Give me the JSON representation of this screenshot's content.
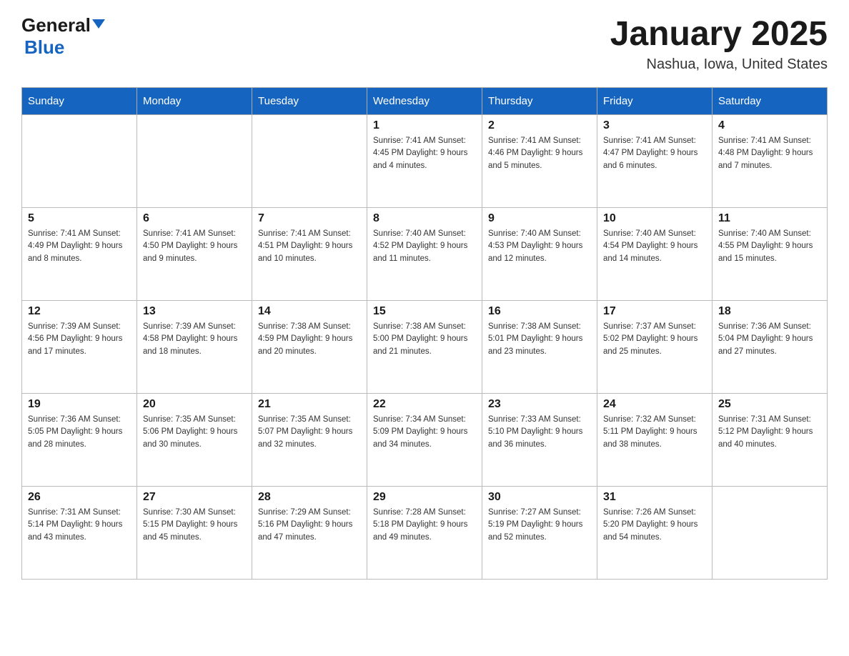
{
  "header": {
    "logo_general": "General",
    "logo_blue": "Blue",
    "month_title": "January 2025",
    "location": "Nashua, Iowa, United States"
  },
  "calendar": {
    "days_of_week": [
      "Sunday",
      "Monday",
      "Tuesday",
      "Wednesday",
      "Thursday",
      "Friday",
      "Saturday"
    ],
    "weeks": [
      [
        {
          "day": "",
          "info": ""
        },
        {
          "day": "",
          "info": ""
        },
        {
          "day": "",
          "info": ""
        },
        {
          "day": "1",
          "info": "Sunrise: 7:41 AM\nSunset: 4:45 PM\nDaylight: 9 hours and 4 minutes."
        },
        {
          "day": "2",
          "info": "Sunrise: 7:41 AM\nSunset: 4:46 PM\nDaylight: 9 hours and 5 minutes."
        },
        {
          "day": "3",
          "info": "Sunrise: 7:41 AM\nSunset: 4:47 PM\nDaylight: 9 hours and 6 minutes."
        },
        {
          "day": "4",
          "info": "Sunrise: 7:41 AM\nSunset: 4:48 PM\nDaylight: 9 hours and 7 minutes."
        }
      ],
      [
        {
          "day": "5",
          "info": "Sunrise: 7:41 AM\nSunset: 4:49 PM\nDaylight: 9 hours and 8 minutes."
        },
        {
          "day": "6",
          "info": "Sunrise: 7:41 AM\nSunset: 4:50 PM\nDaylight: 9 hours and 9 minutes."
        },
        {
          "day": "7",
          "info": "Sunrise: 7:41 AM\nSunset: 4:51 PM\nDaylight: 9 hours and 10 minutes."
        },
        {
          "day": "8",
          "info": "Sunrise: 7:40 AM\nSunset: 4:52 PM\nDaylight: 9 hours and 11 minutes."
        },
        {
          "day": "9",
          "info": "Sunrise: 7:40 AM\nSunset: 4:53 PM\nDaylight: 9 hours and 12 minutes."
        },
        {
          "day": "10",
          "info": "Sunrise: 7:40 AM\nSunset: 4:54 PM\nDaylight: 9 hours and 14 minutes."
        },
        {
          "day": "11",
          "info": "Sunrise: 7:40 AM\nSunset: 4:55 PM\nDaylight: 9 hours and 15 minutes."
        }
      ],
      [
        {
          "day": "12",
          "info": "Sunrise: 7:39 AM\nSunset: 4:56 PM\nDaylight: 9 hours and 17 minutes."
        },
        {
          "day": "13",
          "info": "Sunrise: 7:39 AM\nSunset: 4:58 PM\nDaylight: 9 hours and 18 minutes."
        },
        {
          "day": "14",
          "info": "Sunrise: 7:38 AM\nSunset: 4:59 PM\nDaylight: 9 hours and 20 minutes."
        },
        {
          "day": "15",
          "info": "Sunrise: 7:38 AM\nSunset: 5:00 PM\nDaylight: 9 hours and 21 minutes."
        },
        {
          "day": "16",
          "info": "Sunrise: 7:38 AM\nSunset: 5:01 PM\nDaylight: 9 hours and 23 minutes."
        },
        {
          "day": "17",
          "info": "Sunrise: 7:37 AM\nSunset: 5:02 PM\nDaylight: 9 hours and 25 minutes."
        },
        {
          "day": "18",
          "info": "Sunrise: 7:36 AM\nSunset: 5:04 PM\nDaylight: 9 hours and 27 minutes."
        }
      ],
      [
        {
          "day": "19",
          "info": "Sunrise: 7:36 AM\nSunset: 5:05 PM\nDaylight: 9 hours and 28 minutes."
        },
        {
          "day": "20",
          "info": "Sunrise: 7:35 AM\nSunset: 5:06 PM\nDaylight: 9 hours and 30 minutes."
        },
        {
          "day": "21",
          "info": "Sunrise: 7:35 AM\nSunset: 5:07 PM\nDaylight: 9 hours and 32 minutes."
        },
        {
          "day": "22",
          "info": "Sunrise: 7:34 AM\nSunset: 5:09 PM\nDaylight: 9 hours and 34 minutes."
        },
        {
          "day": "23",
          "info": "Sunrise: 7:33 AM\nSunset: 5:10 PM\nDaylight: 9 hours and 36 minutes."
        },
        {
          "day": "24",
          "info": "Sunrise: 7:32 AM\nSunset: 5:11 PM\nDaylight: 9 hours and 38 minutes."
        },
        {
          "day": "25",
          "info": "Sunrise: 7:31 AM\nSunset: 5:12 PM\nDaylight: 9 hours and 40 minutes."
        }
      ],
      [
        {
          "day": "26",
          "info": "Sunrise: 7:31 AM\nSunset: 5:14 PM\nDaylight: 9 hours and 43 minutes."
        },
        {
          "day": "27",
          "info": "Sunrise: 7:30 AM\nSunset: 5:15 PM\nDaylight: 9 hours and 45 minutes."
        },
        {
          "day": "28",
          "info": "Sunrise: 7:29 AM\nSunset: 5:16 PM\nDaylight: 9 hours and 47 minutes."
        },
        {
          "day": "29",
          "info": "Sunrise: 7:28 AM\nSunset: 5:18 PM\nDaylight: 9 hours and 49 minutes."
        },
        {
          "day": "30",
          "info": "Sunrise: 7:27 AM\nSunset: 5:19 PM\nDaylight: 9 hours and 52 minutes."
        },
        {
          "day": "31",
          "info": "Sunrise: 7:26 AM\nSunset: 5:20 PM\nDaylight: 9 hours and 54 minutes."
        },
        {
          "day": "",
          "info": ""
        }
      ]
    ]
  }
}
